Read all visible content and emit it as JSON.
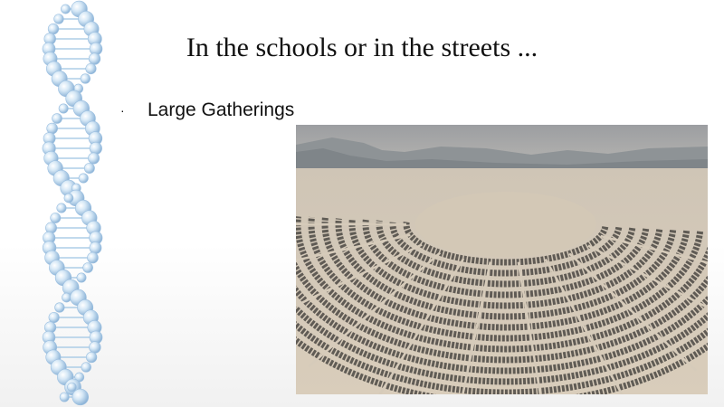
{
  "slide": {
    "title": "In the schools or in the streets ...",
    "bullets": [
      {
        "marker": "·",
        "text": "Large Gatherings"
      }
    ]
  },
  "decorations": {
    "dna_icon": "dna-helix-icon",
    "dna_color": "#a9cbe6"
  },
  "image": {
    "subject": "aerial-camp-photo",
    "sky_color": "#a7a9ab",
    "ground_color": "#d6cbba",
    "camp_color": "#4b4843"
  }
}
